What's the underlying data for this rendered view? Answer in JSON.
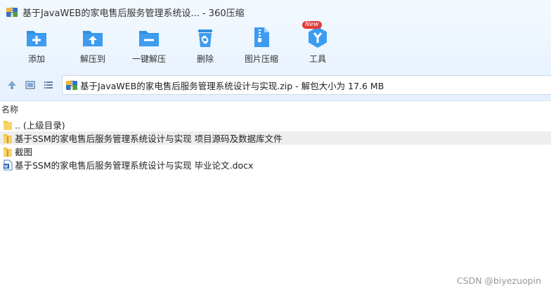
{
  "window": {
    "title": "基于JavaWEB的家电售后服务管理系统设... - 360压缩"
  },
  "toolbar": {
    "items": [
      {
        "label": "添加",
        "icon": "add-folder-icon"
      },
      {
        "label": "解压到",
        "icon": "extract-to-icon"
      },
      {
        "label": "一键解压",
        "icon": "one-click-extract-icon"
      },
      {
        "label": "删除",
        "icon": "delete-icon"
      },
      {
        "label": "图片压缩",
        "icon": "image-compress-icon"
      },
      {
        "label": "工具",
        "icon": "tools-icon",
        "badge": "New"
      }
    ]
  },
  "address": {
    "path": "基于JavaWEB的家电售后服务管理系统设计与实现.zip - 解包大小为 17.6 MB"
  },
  "columns": {
    "name": "名称"
  },
  "files": [
    {
      "name": ".. (上级目录)",
      "type": "folder"
    },
    {
      "name": "基于SSM的家电售后服务管理系统设计与实现 项目源码及数据库文件",
      "type": "folder"
    },
    {
      "name": "截图",
      "type": "folder"
    },
    {
      "name": "基于SSM的家电售后服务管理系统设计与实现 毕业论文.docx",
      "type": "docx"
    }
  ],
  "watermark": "CSDN @biyezuopin",
  "colors": {
    "accent": "#2f8fe0",
    "folder": "#f5c342",
    "badge": "#e23b3b"
  }
}
